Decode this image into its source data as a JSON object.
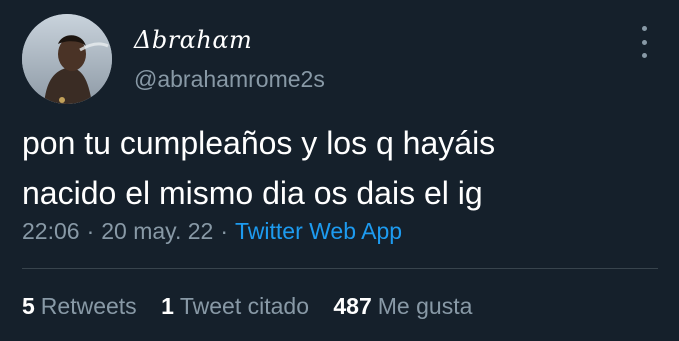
{
  "author": {
    "display_name": "Δbrαhαm",
    "handle": "@abrahamrome2s",
    "avatar_icon": "profile-photo"
  },
  "tweet": {
    "text_line1": "pon tu cumpleaños y los q hayáis",
    "text_line2": "nacido el mismo dia os dais el ig",
    "time": "22:06",
    "separator": "·",
    "date": "20 may. 22",
    "source": "Twitter Web App"
  },
  "stats": {
    "retweets_count": "5",
    "retweets_label": "Retweets",
    "quotes_count": "1",
    "quotes_label": "Tweet citado",
    "likes_count": "487",
    "likes_label": "Me gusta"
  },
  "colors": {
    "background": "#15202b",
    "secondary_text": "#8899a6",
    "link": "#1d9bf0",
    "divider": "#38444d"
  },
  "icons": {
    "more": "more-options-icon"
  }
}
